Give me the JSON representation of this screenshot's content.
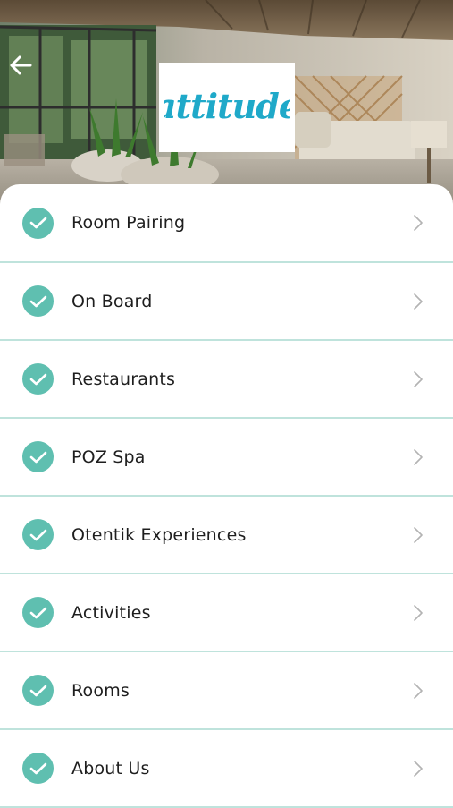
{
  "header": {
    "brand_logo_text": "attitude",
    "back_icon": "arrow-left-icon",
    "hero_image": "resort-lounge-photo"
  },
  "colors": {
    "accent": "#5fbfb0",
    "divider": "#bfe3dc",
    "logo": "#1fa9c9",
    "text": "#1e1e1e"
  },
  "menu": {
    "items": [
      {
        "label": "Room Pairing",
        "icon": "check-circle-icon"
      },
      {
        "label": "On Board",
        "icon": "check-circle-icon"
      },
      {
        "label": "Restaurants",
        "icon": "check-circle-icon"
      },
      {
        "label": "POZ Spa",
        "icon": "check-circle-icon"
      },
      {
        "label": "Otentik Experiences",
        "icon": "check-circle-icon"
      },
      {
        "label": "Activities",
        "icon": "check-circle-icon"
      },
      {
        "label": "Rooms",
        "icon": "check-circle-icon"
      },
      {
        "label": "About Us",
        "icon": "check-circle-icon"
      }
    ]
  }
}
